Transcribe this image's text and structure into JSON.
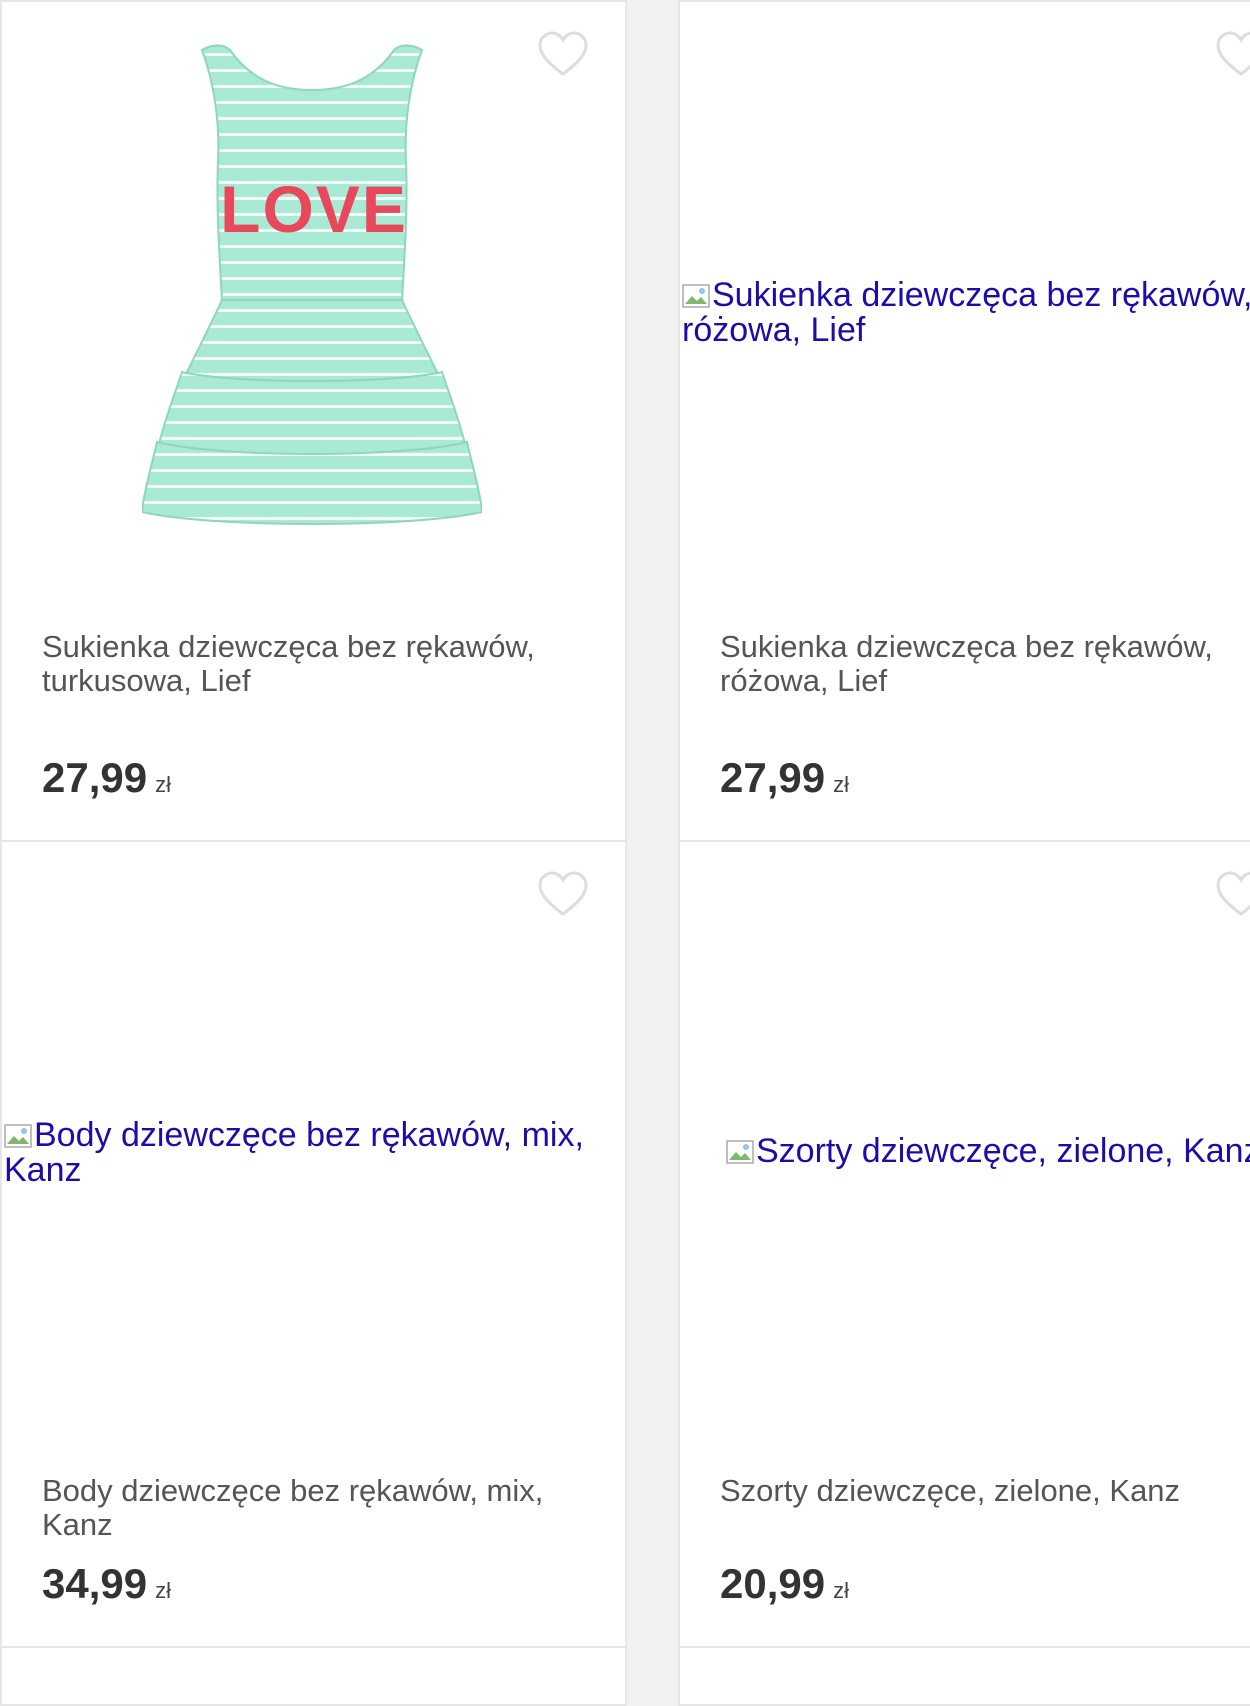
{
  "currency": "zł",
  "heart_icon": "heart-outline-icon",
  "broken_image_icon": "broken-image-icon",
  "colors": {
    "link_blue": "#1a0dab",
    "title_gray": "#555555",
    "price_dark": "#333333",
    "card_border": "#e6e6e6",
    "mint": "#a8ead3"
  },
  "products": [
    {
      "title": "Sukienka dziewczęca bez rękawów, turkusowa, Lief",
      "price": "27,99",
      "image_alt": "",
      "image_print": "LOVE"
    },
    {
      "title": "Sukienka dziewczęca bez rękawów, różowa, Lief",
      "price": "27,99",
      "image_alt": "Sukienka dziewczęca bez rękawów, różowa, Lief"
    },
    {
      "title": "Body dziewczęce bez rękawów, mix, Kanz",
      "price": "34,99",
      "image_alt": "Body dziewczęce bez rękawów, mix, Kanz"
    },
    {
      "title": "Szorty dziewczęce, zielone, Kanz",
      "price": "20,99",
      "image_alt": "Szorty dziewczęce, zielone, Kanz"
    }
  ]
}
